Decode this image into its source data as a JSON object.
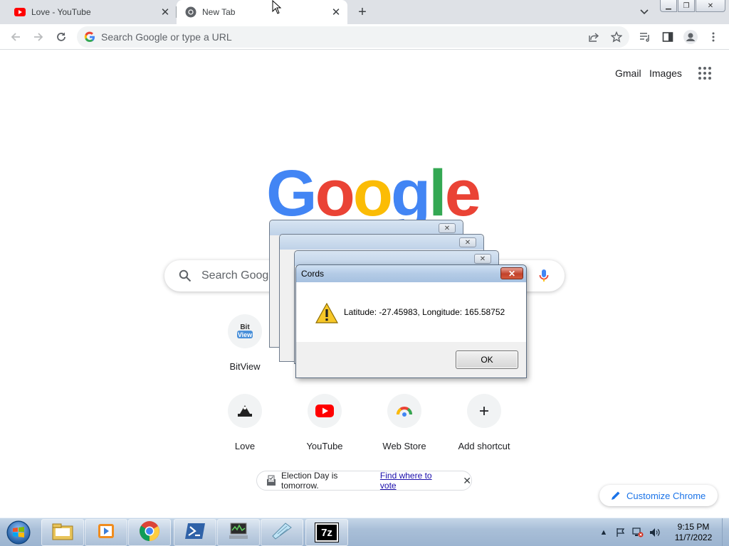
{
  "browser": {
    "tabs": [
      {
        "title": "Love - YouTube",
        "active": false,
        "icon": "youtube-icon"
      },
      {
        "title": "New Tab",
        "active": true,
        "icon": "chrome-icon"
      }
    ],
    "omnibox": {
      "placeholder": "Search Google or type a URL",
      "value": ""
    }
  },
  "ntp": {
    "header_links": {
      "gmail": "Gmail",
      "images": "Images"
    },
    "logo_letters": [
      "G",
      "o",
      "o",
      "g",
      "l",
      "e"
    ],
    "logo_colors": [
      "#4285f4",
      "#ea4335",
      "#fbbc05",
      "#4285f4",
      "#34a853",
      "#ea4335"
    ],
    "search": {
      "placeholder": "Search Google or type a URL"
    },
    "shortcuts": [
      {
        "label": "BitView",
        "icon": "bitview-icon"
      },
      {
        "label": "Love",
        "icon": "love-icon"
      },
      {
        "label": "YouTube",
        "icon": "youtube-icon"
      },
      {
        "label": "Web Store",
        "icon": "webstore-icon"
      },
      {
        "label": "Add shortcut",
        "icon": "plus-icon"
      }
    ],
    "notice": {
      "text": "Election Day is tomorrow.",
      "link": "Find where to vote"
    },
    "customize": {
      "label": "Customize Chrome"
    }
  },
  "dialog": {
    "title": "Cords",
    "message": "Latitude: -27.45983, Longitude: 165.58752",
    "ok_label": "OK",
    "stacked_windows": 3
  },
  "taskbar": {
    "items": [
      "windows-explorer-icon",
      "media-player-icon",
      "chrome-icon",
      "powershell-icon",
      "network-monitor-icon",
      "notepad-icon",
      "7zip-icon"
    ],
    "seven_zip_label": "7z",
    "clock": {
      "time": "9:15 PM",
      "date": "11/7/2022"
    }
  },
  "colors": {
    "tabstrip": "#dee1e6",
    "accent": "#1a73e8",
    "youtube_red": "#ff0000"
  }
}
